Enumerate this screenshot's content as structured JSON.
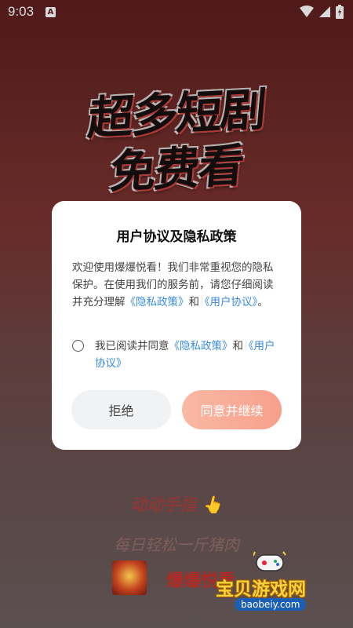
{
  "status_bar": {
    "time": "9:03",
    "notif_icon": "A"
  },
  "hero": {
    "line1": "超多短剧",
    "line2": "免费看"
  },
  "dialog": {
    "title": "用户协议及隐私政策",
    "body_prefix": "欢迎使用爆爆悦看！我们非常重视您的隐私保护。在使用我们的服务前，请您仔细阅读并充分理解",
    "privacy_link": "《隐私政策》",
    "and": "和",
    "user_link": "《用户协议》",
    "body_suffix": "。",
    "agree_prefix": "我已阅读并同意",
    "agree_privacy": "《隐私政策》",
    "agree_and": "和",
    "agree_user": "《用户协议》",
    "reject_label": "拒绝",
    "accept_label": "同意并继续"
  },
  "promo": {
    "line1": "动动手指 👆",
    "line2": "每日轻松一斤猪肉",
    "app_name": "爆爆悦看"
  },
  "watermark": {
    "title": "宝贝游戏网",
    "url": "baobeiy.com"
  },
  "colors": {
    "link": "#3a8be0",
    "accept_button": "#f7a08c",
    "reject_button": "#f1f2f4"
  }
}
